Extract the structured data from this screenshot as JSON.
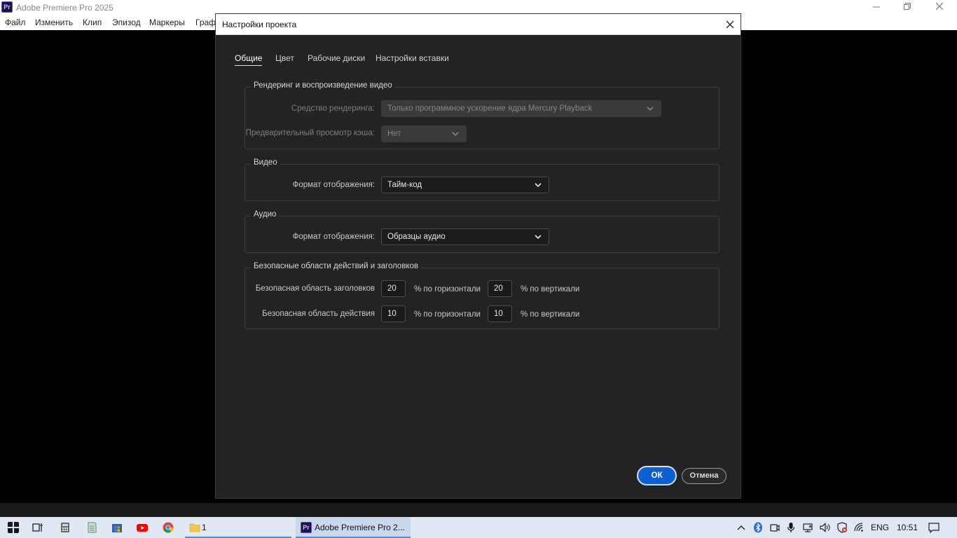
{
  "app": {
    "icon_text": "Pr",
    "title": "Adobe Premiere Pro 2025",
    "menu": [
      "Файл",
      "Изменить",
      "Клип",
      "Эпизод",
      "Маркеры",
      "Граф"
    ]
  },
  "dialog": {
    "title": "Настройки проекта",
    "tabs": [
      {
        "label": "Общие",
        "active": true
      },
      {
        "label": "Цвет",
        "active": false
      },
      {
        "label": "Рабочие диски",
        "active": false
      },
      {
        "label": "Настройки вставки",
        "active": false
      }
    ],
    "rendering": {
      "title": "Рендеринг и воспроизведение видео",
      "renderer_label": "Средство рендеринга:",
      "renderer_value": "Только программное ускорение ядра Mercury Playback",
      "cache_label": "Предварительный просмотр кэша:",
      "cache_value": "Нет"
    },
    "video": {
      "title": "Видео",
      "format_label": "Формат отображения:",
      "format_value": "Тайм-код"
    },
    "audio": {
      "title": "Аудио",
      "format_label": "Формат отображения:",
      "format_value": "Образцы аудио"
    },
    "safe": {
      "title": "Безопасные области действий и заголовков",
      "title_safe_label": "Безопасная область заголовков",
      "title_h": "20",
      "title_v": "20",
      "action_safe_label": "Безопасная область действия",
      "action_h": "10",
      "action_v": "10",
      "h_unit": "% по горизонтали",
      "v_unit": "% по вертикали"
    },
    "ok_label": "ОК",
    "cancel_label": "Отмена"
  },
  "taskbar": {
    "folder_label": "1",
    "premiere_icon_text": "Pr",
    "premiere_label": "Adobe Premiere Pro 2...",
    "lang": "ENG",
    "time": "10:51"
  },
  "colors": {
    "dialog_bg": "#232323",
    "accent": "#0e5fd3",
    "taskbar_bg": "#dfe8f3"
  }
}
